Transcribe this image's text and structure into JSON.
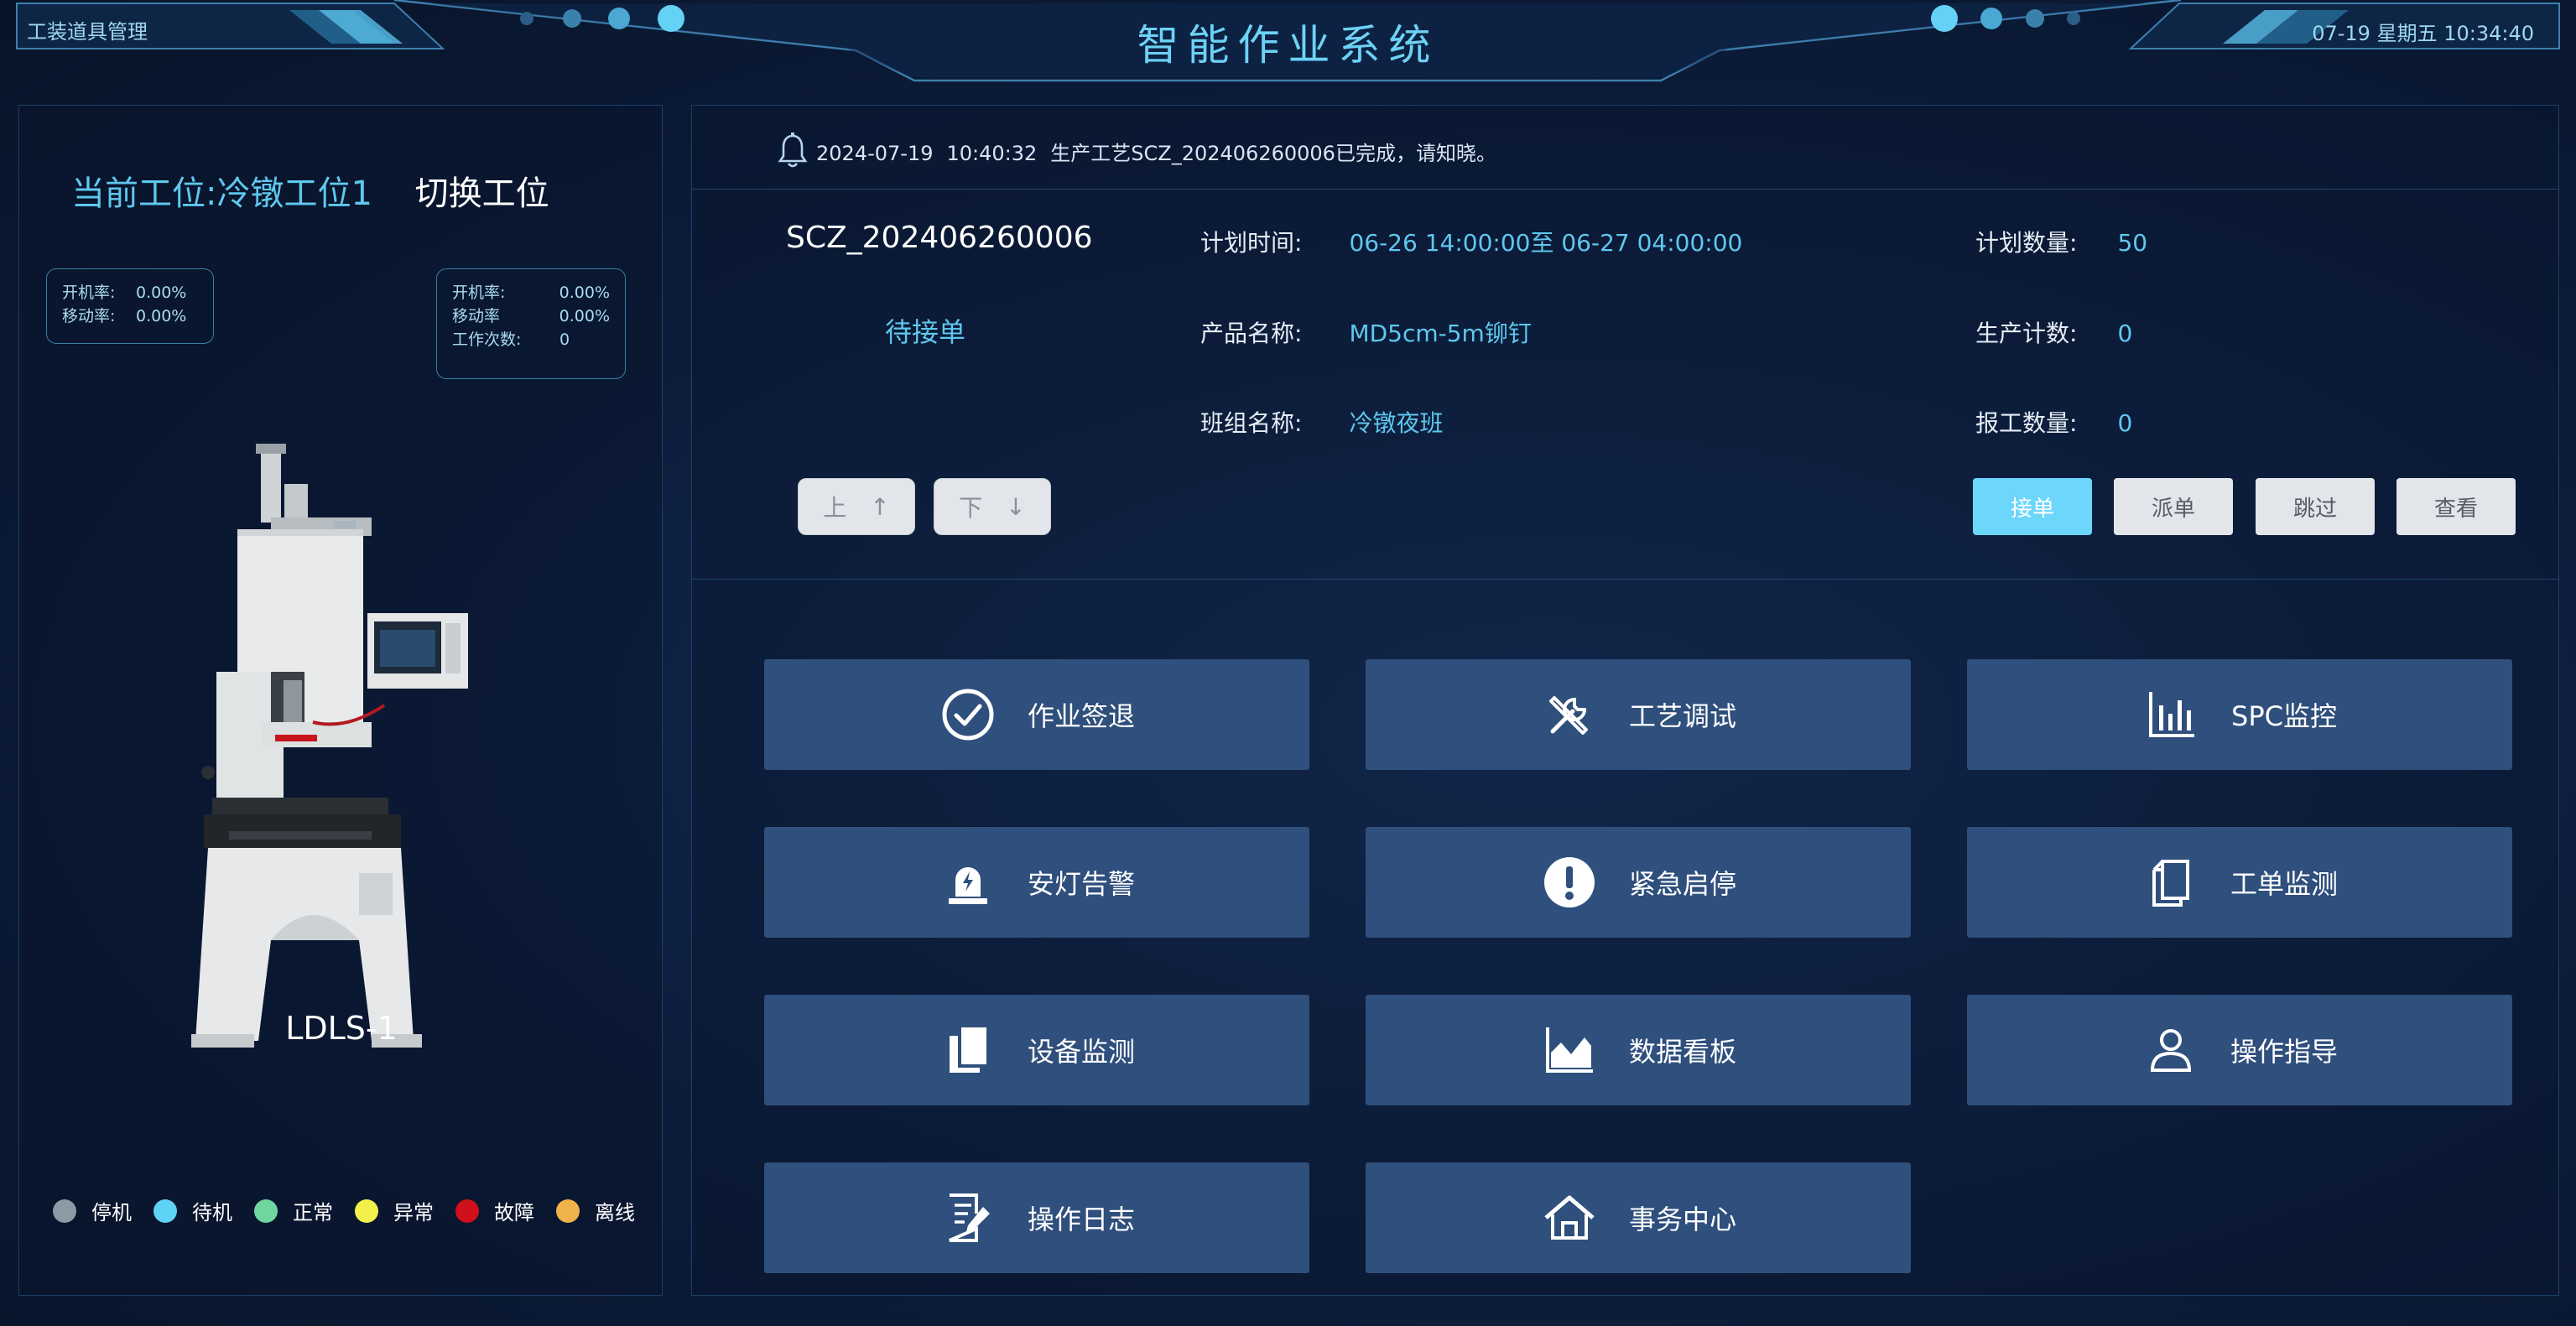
{
  "header": {
    "left_label": "工装道具管理",
    "title": "智能作业系统",
    "clock": "07-19 星期五 10:34:40",
    "accent_color": "#6cd2f6"
  },
  "left_panel": {
    "station_prefix": "当前工位:",
    "station_name": "冷镦工位1",
    "switch_label": "切换工位",
    "stats_left": [
      {
        "label": "开机率:",
        "value": "0.00%"
      },
      {
        "label": "移动率:",
        "value": "0.00%"
      }
    ],
    "stats_right": [
      {
        "label": "开机率:",
        "value": "0.00%"
      },
      {
        "label": "移动率",
        "value": "0.00%"
      },
      {
        "label": "工作次数:",
        "value": "0"
      }
    ],
    "machine_name": "LDLS-1",
    "legend": [
      {
        "label": "停机",
        "color": "#8c9aa6"
      },
      {
        "label": "待机",
        "color": "#5fd3f5"
      },
      {
        "label": "正常",
        "color": "#6fd6a0"
      },
      {
        "label": "异常",
        "color": "#f3f04a"
      },
      {
        "label": "故障",
        "color": "#d0101a"
      },
      {
        "label": "离线",
        "color": "#f0b24a"
      }
    ]
  },
  "notice": {
    "date": "2024-07-19",
    "time": "10:40:32",
    "message": "生产工艺SCZ_202406260006已完成，请知晓。",
    "icon": "bell-icon"
  },
  "order": {
    "code": "SCZ_202406260006",
    "status": "待接单",
    "plan_time_label": "计划时间:",
    "plan_time_value": "06-26  14:00:00至 06-27 04:00:00",
    "product_label": "产品名称:",
    "product_value": "MD5cm-5m铆钉",
    "team_label": "班组名称:",
    "team_value": "冷镦夜班",
    "plan_qty_label": "计划数量:",
    "plan_qty_value": "50",
    "prod_count_label": "生产计数:",
    "prod_count_value": "0",
    "report_qty_label": "报工数量:",
    "report_qty_value": "0",
    "up_label": "上",
    "up_arrow": "↑",
    "down_label": "下",
    "down_arrow": "↓",
    "actions": {
      "accept": "接单",
      "dispatch": "派单",
      "skip": "跳过",
      "view": "查看"
    }
  },
  "tiles": [
    {
      "label": "作业签退",
      "icon": "check-circle-icon"
    },
    {
      "label": "工艺调试",
      "icon": "tools-icon"
    },
    {
      "label": "SPC监控",
      "icon": "bar-chart-icon"
    },
    {
      "label": "安灯告警",
      "icon": "alarm-light-icon"
    },
    {
      "label": "紧急启停",
      "icon": "exclamation-circle-icon"
    },
    {
      "label": "工单监测",
      "icon": "documents-icon"
    },
    {
      "label": "设备监测",
      "icon": "files-icon"
    },
    {
      "label": "数据看板",
      "icon": "area-chart-icon"
    },
    {
      "label": "操作指导",
      "icon": "user-icon"
    },
    {
      "label": "操作日志",
      "icon": "log-edit-icon"
    },
    {
      "label": "事务中心",
      "icon": "home-icon"
    }
  ]
}
